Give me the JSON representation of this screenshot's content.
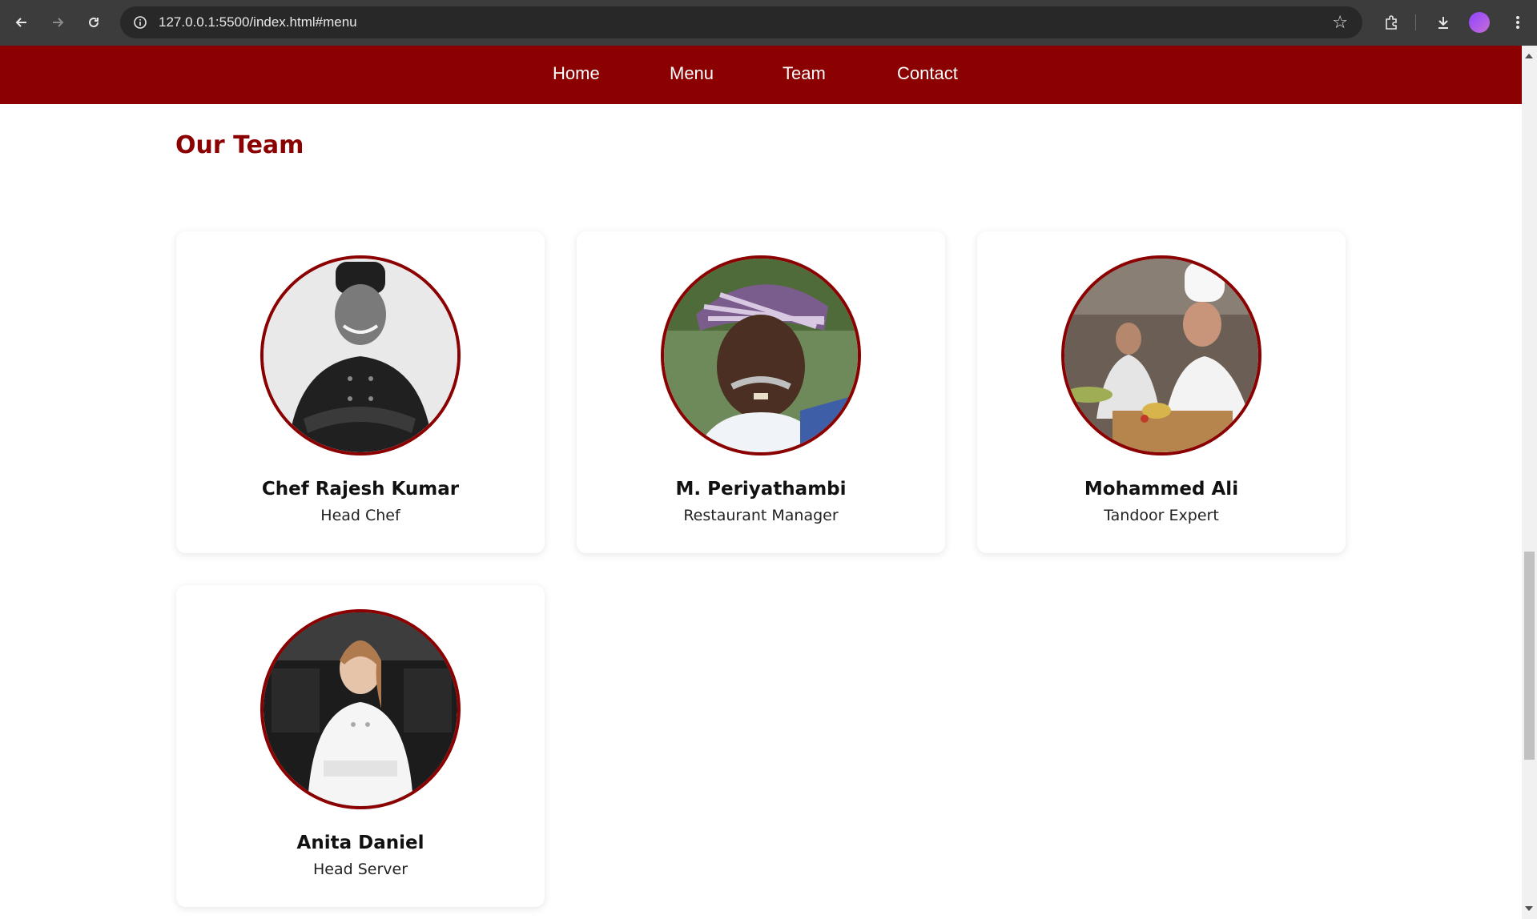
{
  "browser": {
    "url": "127.0.0.1:5500/index.html#menu"
  },
  "nav": {
    "items": [
      "Home",
      "Menu",
      "Team",
      "Contact"
    ]
  },
  "section": {
    "title": "Our Team"
  },
  "team": [
    {
      "name": "Chef Rajesh Kumar",
      "role": "Head Chef"
    },
    {
      "name": "M. Periyathambi",
      "role": "Restaurant Manager"
    },
    {
      "name": "Mohammed Ali",
      "role": "Tandoor Expert"
    },
    {
      "name": "Anita Daniel",
      "role": "Head Server"
    }
  ],
  "colors": {
    "brand": "#8b0000",
    "chrome": "#3c3c3c"
  }
}
